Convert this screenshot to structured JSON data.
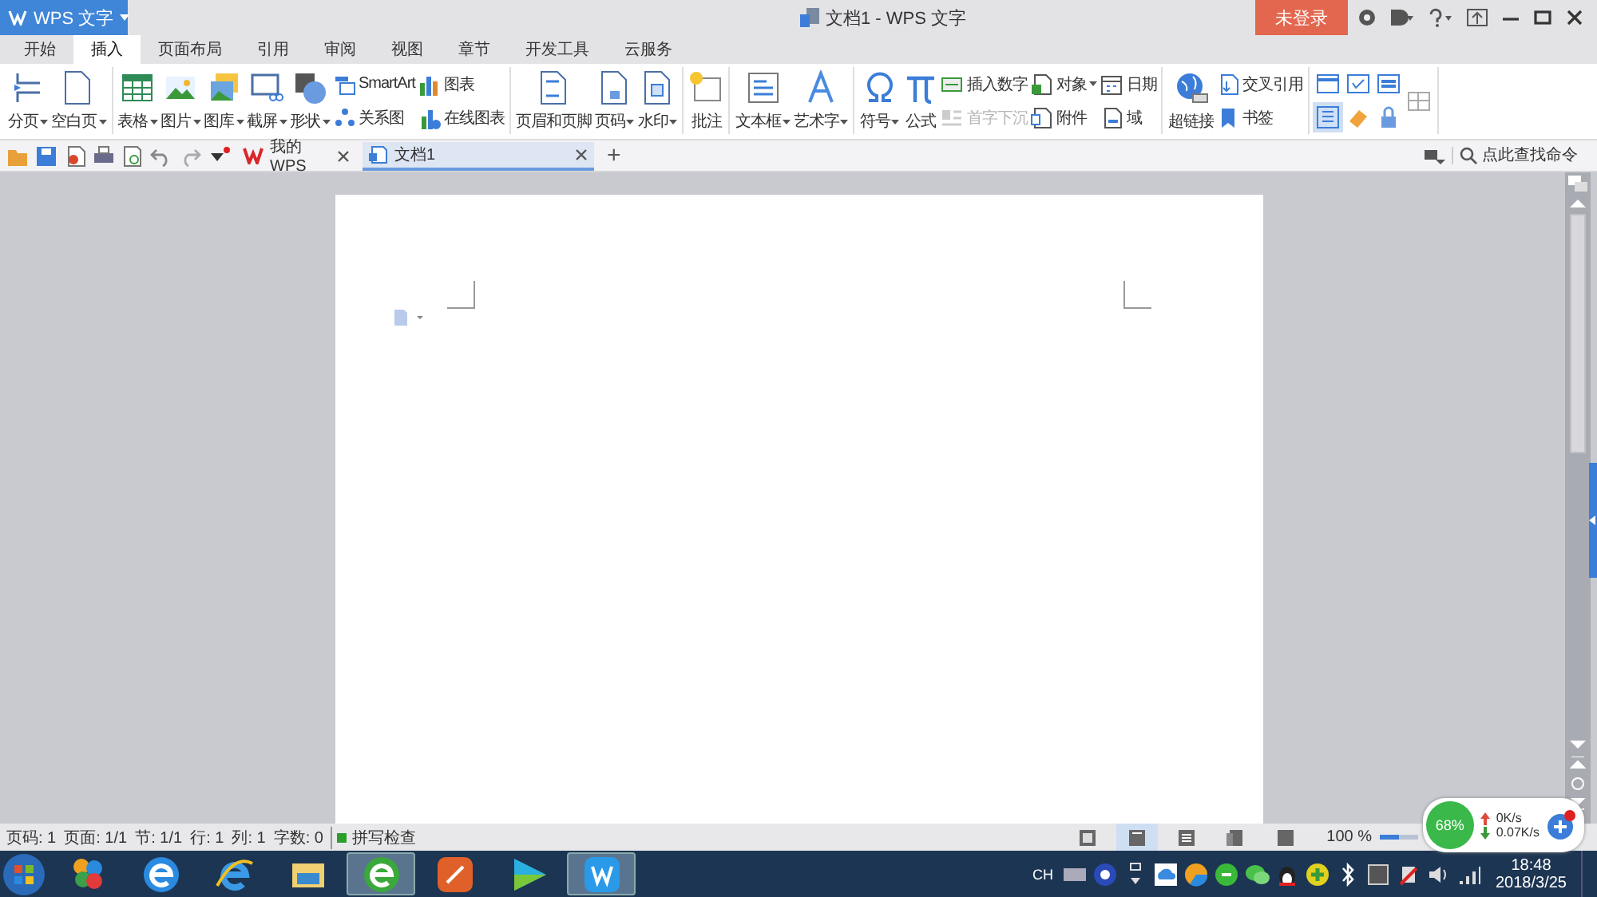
{
  "window": {
    "app_button": "WPS 文字",
    "title": "文档1 - WPS 文字",
    "login_button": "未登录"
  },
  "tabs": [
    {
      "label": "开始",
      "selected": false
    },
    {
      "label": "插入",
      "selected": true
    },
    {
      "label": "页面布局",
      "selected": false
    },
    {
      "label": "引用",
      "selected": false
    },
    {
      "label": "审阅",
      "selected": false
    },
    {
      "label": "视图",
      "selected": false
    },
    {
      "label": "章节",
      "selected": false
    },
    {
      "label": "开发工具",
      "selected": false
    },
    {
      "label": "云服务",
      "selected": false
    }
  ],
  "ribbon": [
    {
      "columns": [
        [
          {
            "label": "分页",
            "kind": "large",
            "dropdown": true
          }
        ],
        [
          {
            "label": "空白页",
            "kind": "large",
            "dropdown": true
          }
        ]
      ]
    },
    {
      "columns": [
        [
          {
            "label": "表格",
            "kind": "large",
            "dropdown": true
          }
        ],
        [
          {
            "label": "图片",
            "kind": "large",
            "dropdown": true
          }
        ],
        [
          {
            "label": "图库",
            "kind": "large",
            "dropdown": true
          }
        ],
        [
          {
            "label": "截屏",
            "kind": "large",
            "dropdown": true
          }
        ],
        [
          {
            "label": "形状",
            "kind": "large",
            "dropdown": true
          }
        ],
        [
          {
            "label": "SmartArt",
            "kind": "small",
            "dropdown": false
          },
          {
            "label": "关系图",
            "kind": "small",
            "dropdown": false
          }
        ],
        [
          {
            "label": "图表",
            "kind": "small",
            "dropdown": false
          },
          {
            "label": "在线图表",
            "kind": "small",
            "dropdown": false
          }
        ]
      ]
    },
    {
      "columns": [
        [
          {
            "label": "页眉和页脚",
            "kind": "large",
            "dropdown": false
          }
        ],
        [
          {
            "label": "页码",
            "kind": "large",
            "dropdown": true
          }
        ],
        [
          {
            "label": "水印",
            "kind": "large",
            "dropdown": true
          }
        ]
      ]
    },
    {
      "columns": [
        [
          {
            "label": "批注",
            "kind": "large",
            "dropdown": false
          }
        ]
      ]
    },
    {
      "columns": [
        [
          {
            "label": "文本框",
            "kind": "large",
            "dropdown": true
          }
        ],
        [
          {
            "label": "艺术字",
            "kind": "large",
            "dropdown": true
          }
        ]
      ]
    },
    {
      "columns": [
        [
          {
            "label": "符号",
            "kind": "large",
            "dropdown": true
          }
        ],
        [
          {
            "label": "公式",
            "kind": "large",
            "dropdown": false
          }
        ],
        [
          {
            "label": "插入数字",
            "kind": "small",
            "dropdown": false,
            "disabled": false
          },
          {
            "label": "首字下沉",
            "kind": "small",
            "dropdown": false,
            "disabled": true
          }
        ],
        [
          {
            "label": "对象",
            "kind": "small",
            "dropdown": true
          },
          {
            "label": "附件",
            "kind": "small",
            "dropdown": false
          }
        ],
        [
          {
            "label": "日期",
            "kind": "small",
            "dropdown": false
          },
          {
            "label": "域",
            "kind": "small",
            "dropdown": false
          }
        ]
      ]
    },
    {
      "columns": [
        [
          {
            "label": "超链接",
            "kind": "large",
            "dropdown": false
          }
        ],
        [
          {
            "label": "交叉引用",
            "kind": "small",
            "dropdown": false
          },
          {
            "label": "书签",
            "kind": "small",
            "dropdown": false
          }
        ]
      ]
    },
    {
      "columns": [
        [
          {
            "kind": "icon",
            "selected": false
          },
          {
            "kind": "icon",
            "selected": true
          }
        ],
        [
          {
            "kind": "icon",
            "selected": false
          },
          {
            "kind": "icon",
            "selected": false
          }
        ],
        [
          {
            "kind": "icon",
            "selected": false
          },
          {
            "kind": "icon",
            "selected": false
          }
        ],
        [
          {
            "kind": "icon",
            "selected": false
          }
        ]
      ]
    }
  ],
  "doc_tabs": [
    {
      "label": "我的WPS",
      "selected": false
    },
    {
      "label": "文档1",
      "selected": true
    }
  ],
  "new_tab": "+",
  "command_search": {
    "placeholder": "点此查找命令"
  },
  "status_bar": {
    "items": [
      "页码: 1",
      "页面: 1/1",
      "节: 1/1",
      "行: 1",
      "列: 1",
      "字数: 0"
    ],
    "spell_check": "拼写检查",
    "views": [
      {
        "selected": false
      },
      {
        "selected": true
      },
      {
        "selected": false
      },
      {
        "selected": false
      },
      {
        "selected": false
      }
    ],
    "zoom": "100 %",
    "zoom_slider": {
      "level": 0.5
    }
  },
  "net_widget": {
    "percent": "68%",
    "upload": "0K/s",
    "download": "0.07K/s"
  },
  "taskbar": {
    "apps": [
      {
        "selected": false
      },
      {
        "selected": false
      },
      {
        "selected": false
      },
      {
        "selected": false
      },
      {
        "selected": true
      },
      {
        "selected": false
      },
      {
        "selected": false
      },
      {
        "selected": true
      }
    ],
    "language": "CH",
    "time": "18:48",
    "date": "2018/3/25"
  }
}
